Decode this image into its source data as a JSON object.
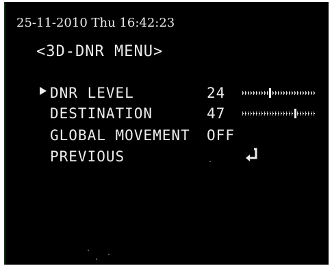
{
  "osd": {
    "datetime": "25-11-2010 Thu 16:42:23",
    "title": "<3D-DNR MENU>",
    "items": [
      {
        "label": "DNR LEVEL",
        "value": "24",
        "control": "slider",
        "level": 24
      },
      {
        "label": "DESTINATION",
        "value": "47",
        "control": "slider",
        "level": 47
      },
      {
        "label": "GLOBAL MOVEMENT",
        "value": "OFF",
        "control": "text"
      },
      {
        "label": "PREVIOUS",
        "value": "",
        "control": "enter-icon"
      }
    ],
    "selected_index": 0,
    "slider_max": 64,
    "colors": {
      "background": "#000000",
      "text": "#ececec",
      "frame": "#ffffff"
    },
    "icons": {
      "cursor": "triangle-right-icon",
      "enter": "enter-return-icon"
    }
  }
}
